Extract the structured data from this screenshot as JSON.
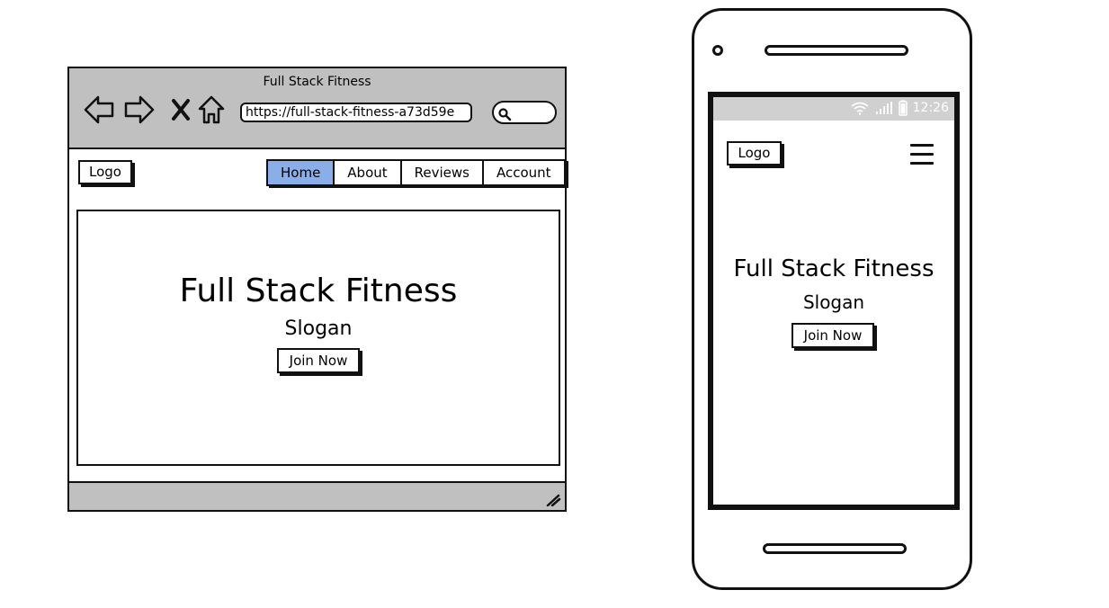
{
  "browser": {
    "window_title": "Full Stack Fitness",
    "url": "https://full-stack-fitness-a73d59e",
    "nav_icons": [
      "back-arrow-icon",
      "forward-arrow-icon",
      "close-icon",
      "home-icon"
    ],
    "search_icon": "search-icon"
  },
  "desktop": {
    "logo_label": "Logo",
    "tabs": [
      {
        "label": "Home",
        "active": true
      },
      {
        "label": "About",
        "active": false
      },
      {
        "label": "Reviews",
        "active": false
      },
      {
        "label": "Account",
        "active": false
      }
    ],
    "hero": {
      "title": "Full Stack Fitness",
      "slogan": "Slogan",
      "cta_label": "Join Now"
    }
  },
  "mobile": {
    "status_time": "12:26",
    "logo_label": "Logo",
    "menu_icon": "hamburger-menu-icon",
    "hero": {
      "title": "Full Stack Fitness",
      "slogan": "Slogan",
      "cta_label": "Join Now"
    }
  },
  "colors": {
    "active_tab": "#8aaee8",
    "chrome_gray": "#c0c0c0",
    "status_bar_gray": "#d0d0d0"
  }
}
